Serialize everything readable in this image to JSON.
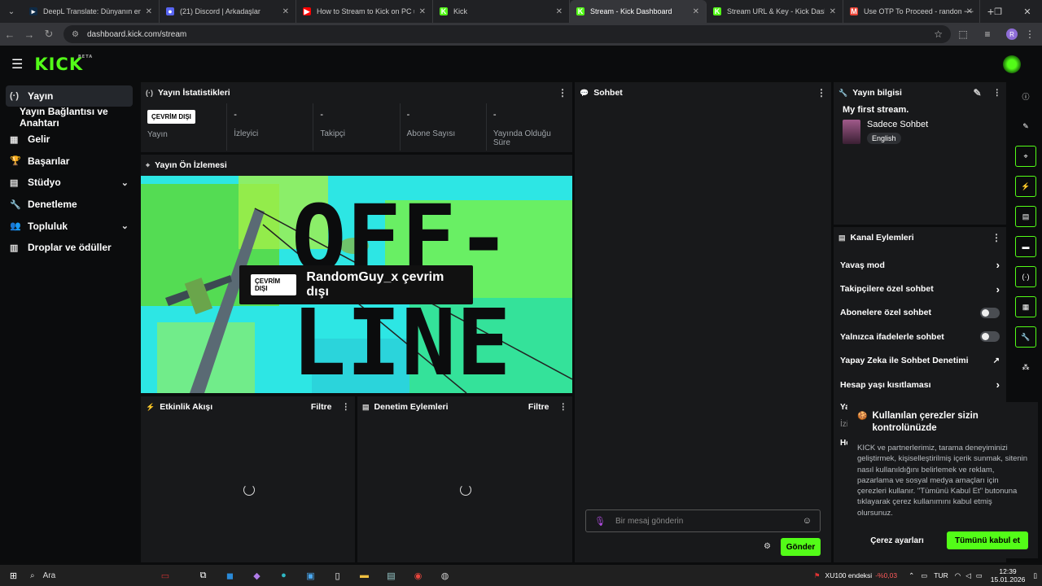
{
  "browser": {
    "tabs": [
      {
        "title": "DeepL Translate: Dünyanın en iyi",
        "fav_color": "#0f2b46",
        "fav": "▸"
      },
      {
        "title": "(21) Discord | Arkadaşlar",
        "fav_color": "#5865f2",
        "fav": "●"
      },
      {
        "title": "How to Stream to Kick on PC u",
        "fav_color": "#ff0000",
        "fav": "▶"
      },
      {
        "title": "Kick",
        "fav_color": "#53fc18",
        "fav": "K"
      },
      {
        "title": "Stream - Kick Dashboard",
        "fav_color": "#53fc18",
        "fav": "K",
        "active": true
      },
      {
        "title": "Stream URL & Key - Kick Dashb",
        "fav_color": "#53fc18",
        "fav": "K"
      },
      {
        "title": "Use OTP To Proceed - random",
        "fav_color": "#ea4335",
        "fav": "M"
      }
    ],
    "url": "dashboard.kick.com/stream",
    "profile_initial": "R"
  },
  "sidebar": {
    "items": [
      {
        "label": "Yayın",
        "icon": "(·)",
        "name": "sidebar-item-yayin",
        "active": true
      },
      {
        "label": "Yayın Bağlantısı ve Anahtarı",
        "icon": "",
        "name": "sidebar-item-yayin-baglantisi",
        "sub": true
      },
      {
        "label": "Gelir",
        "icon": "▦",
        "name": "sidebar-item-gelir"
      },
      {
        "label": "Başarılar",
        "icon": "🏆",
        "name": "sidebar-item-basarilar"
      },
      {
        "label": "Stüdyo",
        "icon": "▤",
        "name": "sidebar-item-studyo",
        "chevron": true
      },
      {
        "label": "Denetleme",
        "icon": "🔧",
        "name": "sidebar-item-denetleme"
      },
      {
        "label": "Topluluk",
        "icon": "👥",
        "name": "sidebar-item-topluluk",
        "chevron": true
      },
      {
        "label": "Droplar ve ödüller",
        "icon": "▥",
        "name": "sidebar-item-droplar"
      }
    ]
  },
  "stats_panel": {
    "title": "Yayın İstatistikleri",
    "status_badge": "ÇEVRİM DIŞI",
    "stats": [
      {
        "value": "",
        "label": "Yayın"
      },
      {
        "value": "-",
        "label": "İzleyici"
      },
      {
        "value": "-",
        "label": "Takipçi"
      },
      {
        "value": "-",
        "label": "Abone Sayısı"
      },
      {
        "value": "-",
        "label": "Yayında Olduğu Süre"
      }
    ]
  },
  "preview_panel": {
    "title": "Yayın Ön İzlemesi",
    "badge": "ÇEVRİM DIŞI",
    "offline_text": "RandomGuy_x çevrim dışı",
    "bg_text_1": "OFF-",
    "bg_text_2": "LINE"
  },
  "activity_panel": {
    "title": "Etkinlik Akışı",
    "filter": "Filtre"
  },
  "mod_panel": {
    "title": "Denetim Eylemleri",
    "filter": "Filtre"
  },
  "chat_panel": {
    "title": "Sohbet",
    "placeholder": "Bir mesaj gönderin",
    "send": "Gönder"
  },
  "info_panel": {
    "title": "Yayın bilgisi",
    "stream_title": "My first stream.",
    "category": "Sadece Sohbet",
    "language": "English"
  },
  "channel_actions": {
    "title": "Kanal Eylemleri",
    "items": [
      {
        "label": "Yavaş mod",
        "type": "chevron",
        "name": "action-yavas-mod"
      },
      {
        "label": "Takipçilere özel sohbet",
        "type": "chevron",
        "name": "action-takipci-sohbet"
      },
      {
        "label": "Abonelere özel sohbet",
        "type": "toggle",
        "name": "action-abone-sohbet"
      },
      {
        "label": "Yalnızca ifadelerle sohbet",
        "type": "toggle",
        "name": "action-ifade-sohbet"
      },
      {
        "label": "Yapay Zeka ile Sohbet Denetimi",
        "type": "external",
        "name": "action-yapay-zeka"
      },
      {
        "label": "Hesap yaşı kısıtlaması",
        "type": "chevron",
        "name": "action-hesap-yasi"
      }
    ],
    "hidden_fragments": [
      "Ya",
      "İzi",
      "He"
    ]
  },
  "cookie": {
    "title": "Kullanılan çerezler sizin kontrolünüzde",
    "body": "KICK ve partnerlerimiz, tarama deneyiminizi geliştirmek, kişiselleştirilmiş içerik sunmak, sitenin nasıl kullanıldığını belirlemek ve reklam, pazarlama ve sosyal medya amaçları için çerezleri kullanır. \"Tümünü Kabul Et\" butonuna tıklayarak çerez kullanımını kabul etmiş olursunuz.",
    "settings_button": "Çerez ayarları",
    "accept_button": "Tümünü kabul et"
  },
  "taskbar": {
    "search": "Ara",
    "ticker": "XU100 endeksi",
    "ticker_change": "-%0,03",
    "lang": "TUR",
    "time": "12:39",
    "date": "15.01.2026"
  },
  "colors": {
    "accent": "#53fc18",
    "panel": "#18191b",
    "bg": "#0b0c0d"
  }
}
